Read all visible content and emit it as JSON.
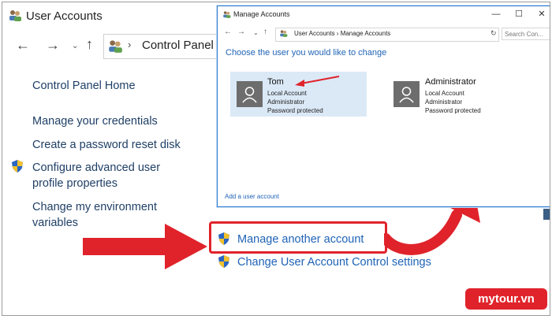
{
  "window": {
    "title": "User Accounts",
    "breadcrumb": "Control Panel"
  },
  "sidebar": {
    "home": "Control Panel Home",
    "items": [
      "Manage your credentials",
      "Create a password reset disk",
      "Configure advanced user",
      "profile properties",
      "Change my environment",
      "variables"
    ]
  },
  "dialog": {
    "title": "Manage Accounts",
    "breadcrumb": "User Accounts  ›  Manage Accounts",
    "search_placeholder": "Search Con...",
    "heading": "Choose the user you would like to change",
    "accounts": [
      {
        "name": "Tom",
        "details": [
          "Local Account",
          "Administrator",
          "Password protected"
        ]
      },
      {
        "name": "Administrator",
        "details": [
          "Local Account",
          "Administrator",
          "Password protected"
        ]
      }
    ],
    "add_user": "Add a user account"
  },
  "main_links": {
    "manage_another": "Manage another account",
    "change_uac": "Change User Account Control settings"
  },
  "brand": {
    "logo_text": "mytour.vn"
  },
  "colors": {
    "accent_red": "#e0232b",
    "link_blue": "#1f63b6",
    "tile_bg": "#dbe9f7"
  }
}
